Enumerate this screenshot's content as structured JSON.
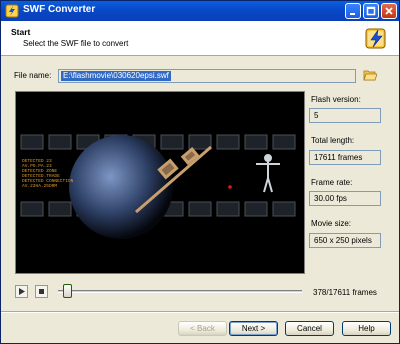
{
  "window": {
    "title": "SWF Converter"
  },
  "header": {
    "title": "Start",
    "subtitle": "Select the SWF file to convert"
  },
  "file": {
    "label": "File name:",
    "value": "E:\\flashmovie\\030620epsi.swf"
  },
  "info": {
    "flash_version_label": "Flash version:",
    "flash_version": "5",
    "total_length_label": "Total length:",
    "total_length": "17611 frames",
    "frame_rate_label": "Frame rate:",
    "frame_rate": "30.00 fps",
    "movie_size_label": "Movie size:",
    "movie_size": "650 x 250 pixels"
  },
  "preview": {
    "text_lines": [
      "DETECTED 23",
      "AV.PO.PA.23",
      "DETECTED ZONE",
      "DETECTED.TRADE",
      "DETECTED CONNECTION",
      "AV.23HA.25DRM"
    ]
  },
  "playback": {
    "frame_counter": "378/17611 frames",
    "progress": 0.0215
  },
  "buttons": {
    "back": "< Back",
    "next": "Next >",
    "cancel": "Cancel",
    "help": "Help"
  },
  "colors": {
    "titlebar": "#0a5fe0",
    "selection": "#316ac5",
    "preview_bg": "#000000"
  }
}
